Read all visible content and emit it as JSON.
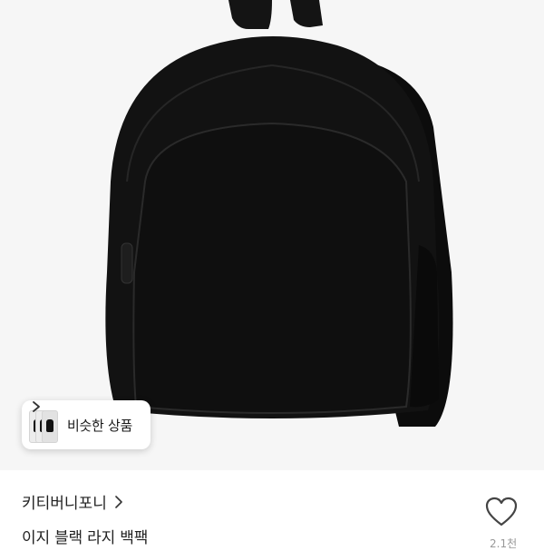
{
  "product_image": {
    "subject": "black backpack",
    "background_color": "#f6f6f6",
    "bag_color": "#111111"
  },
  "similar_products": {
    "label": "비슷한 상품",
    "icon": "chevron-right-icon"
  },
  "brand": {
    "name": "키티버니포니",
    "icon": "chevron-right-icon"
  },
  "product": {
    "name": "이지 블랙 라지 백팩"
  },
  "like": {
    "icon": "heart-outline-icon",
    "count": "2.1천"
  }
}
